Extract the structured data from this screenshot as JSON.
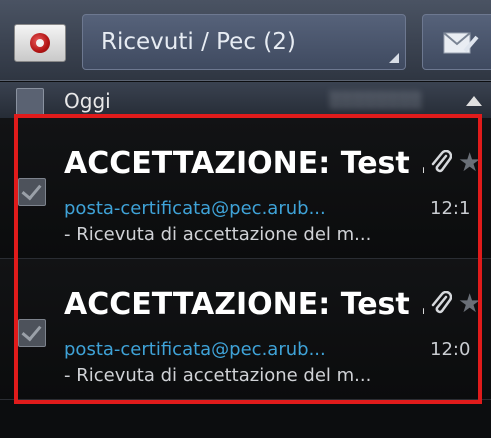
{
  "header": {
    "folder_label": "Ricevuti / Pec (2)"
  },
  "group": {
    "label": "Oggi"
  },
  "messages": [
    {
      "subject": "ACCETTAZIONE: Test ...",
      "sender": "posta-certificata@pec.arub...",
      "time": "12:1",
      "preview": "- Ricevuta di accettazione del m..."
    },
    {
      "subject": "ACCETTAZIONE: Test ...",
      "sender": "posta-certificata@pec.arub...",
      "time": "12:0",
      "preview": "- Ricevuta di accettazione del m..."
    }
  ],
  "colors": {
    "highlight": "#e01b1b",
    "sender_link": "#3fa3d8"
  }
}
